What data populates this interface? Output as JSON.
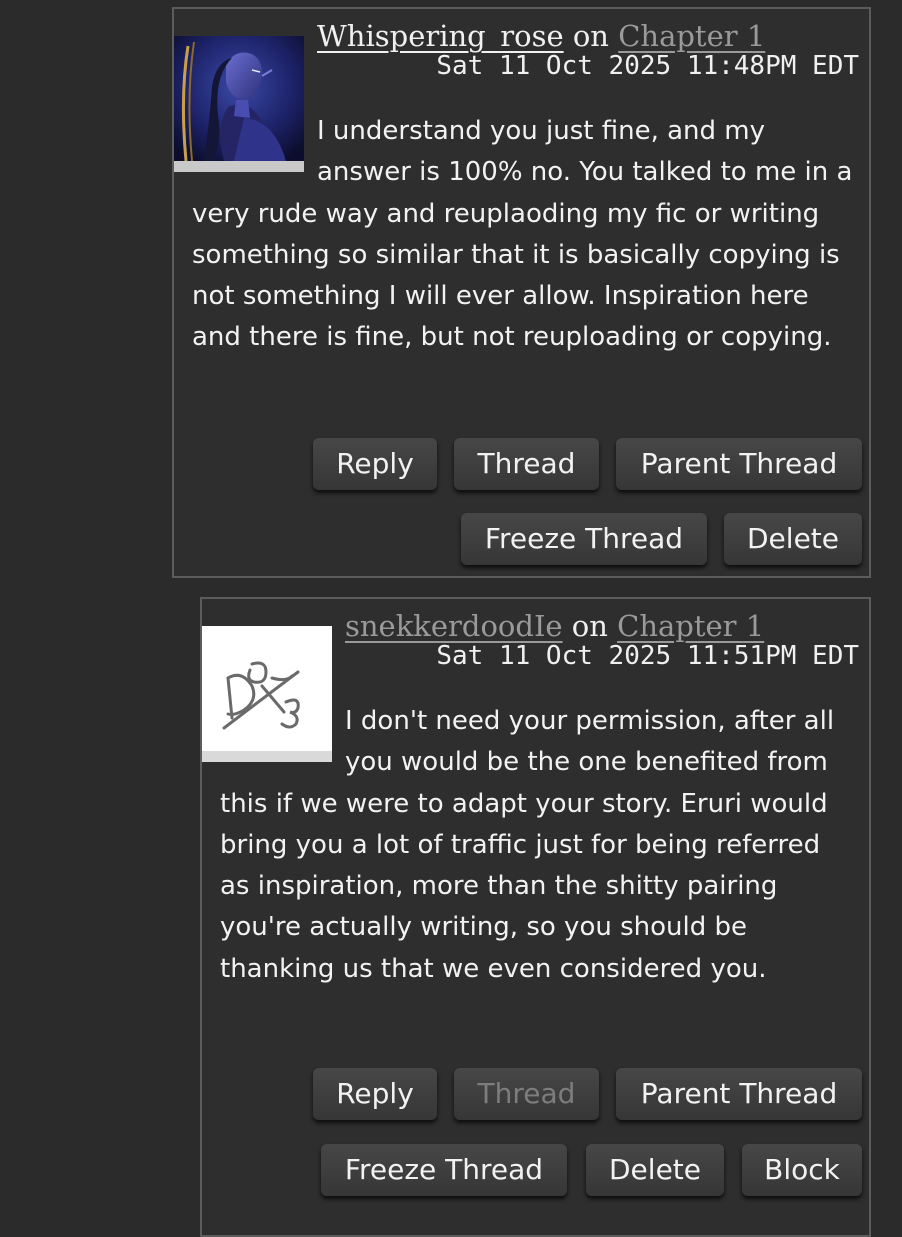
{
  "comments": [
    {
      "author": "Whispering_rose",
      "on_text": "on",
      "chapter": "Chapter 1",
      "timestamp": "Sat 11 Oct 2025 11:48PM EDT",
      "body": "I understand you just fine, and my answer is 100% no. You talked to me in a very rude way and reuplaoding my fic or writing something so similar that it is basically copying is not something I will ever allow. Inspiration here and there is fine, but not reuploading or copying.",
      "buttons": {
        "reply": "Reply",
        "thread": "Thread",
        "parent_thread": "Parent Thread",
        "freeze_thread": "Freeze Thread",
        "delete": "Delete"
      },
      "avatar_icon": "character-portrait-avatar"
    },
    {
      "author": "snekkerdoodIe",
      "on_text": "on",
      "chapter": "Chapter 1",
      "timestamp": "Sat 11 Oct 2025 11:51PM EDT",
      "body": "I don't need your permission, after all you would be the one benefited from this if we were to adapt your story. Eruri would bring you a lot of traffic just for being referred as inspiration, more than the shitty pairing you're actually writing, so you should be thanking us that we even considered you.",
      "buttons": {
        "reply": "Reply",
        "thread": "Thread",
        "parent_thread": "Parent Thread",
        "freeze_thread": "Freeze Thread",
        "delete": "Delete",
        "block": "Block"
      },
      "thread_disabled": true,
      "avatar_icon": "scribble-logo-avatar"
    }
  ],
  "colors": {
    "background": "#2b2b2b",
    "panel": "#2e2e2e",
    "border": "#5c5c5c",
    "link_muted": "#9a9a9a"
  }
}
